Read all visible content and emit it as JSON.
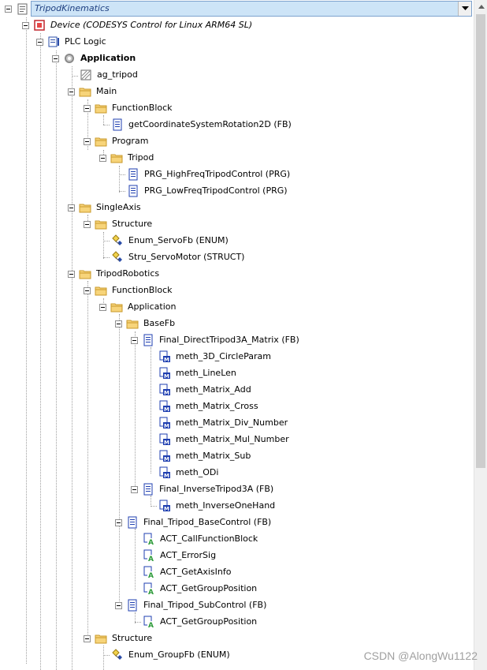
{
  "project": {
    "title": "TripodKinematics"
  },
  "device": {
    "label": "Device (CODESYS Control for Linux ARM64 SL)"
  },
  "plc_logic": {
    "label": "PLC Logic"
  },
  "application": {
    "label": "Application"
  },
  "items": {
    "ag_tripod": "ag_tripod",
    "main": "Main",
    "main_functionblock": "FunctionBlock",
    "getcoord": "getCoordinateSystemRotation2D (FB)",
    "program": "Program",
    "tripod": "Tripod",
    "prg_high": "PRG_HighFreqTripodControl (PRG)",
    "prg_low": "PRG_LowFreqTripodControl (PRG)",
    "singleaxis": "SingleAxis",
    "sa_structure": "Structure",
    "enum_servofb": "Enum_ServoFb (ENUM)",
    "stru_servomotor": "Stru_ServoMotor (STRUCT)",
    "triprob": "TripodRobotics",
    "tr_functionblock": "FunctionBlock",
    "tr_application": "Application",
    "basefb": "BaseFb",
    "final_direct": "Final_DirectTripod3A_Matrix (FB)",
    "meth_3d": "meth_3D_CircleParam",
    "meth_linelen": "meth_LineLen",
    "meth_add": "meth_Matrix_Add",
    "meth_cross": "meth_Matrix_Cross",
    "meth_div": "meth_Matrix_Div_Number",
    "meth_mul": "meth_Matrix_Mul_Number",
    "meth_sub": "meth_Matrix_Sub",
    "meth_odi": "meth_ODi",
    "final_inverse": "Final_InverseTripod3A (FB)",
    "meth_inverse": "meth_InverseOneHand",
    "final_basecontrol": "Final_Tripod_BaseControl (FB)",
    "act_call": "ACT_CallFunctionBlock",
    "act_errorsig": "ACT_ErrorSig",
    "act_getaxis": "ACT_GetAxisInfo",
    "act_getgroup1": "ACT_GetGroupPosition",
    "final_subcontrol": "Final_Tripod_SubControl (FB)",
    "act_getgroup2": "ACT_GetGroupPosition",
    "tr_structure": "Structure",
    "enum_groupfb": "Enum_GroupFb (ENUM)"
  },
  "watermark": "CSDN @AlongWu1122",
  "colors": {
    "folder": "#f0c64a",
    "pou_blue": "#1f3fb0",
    "action_green": "#2e9b3a",
    "selection": "#cde4f7"
  }
}
